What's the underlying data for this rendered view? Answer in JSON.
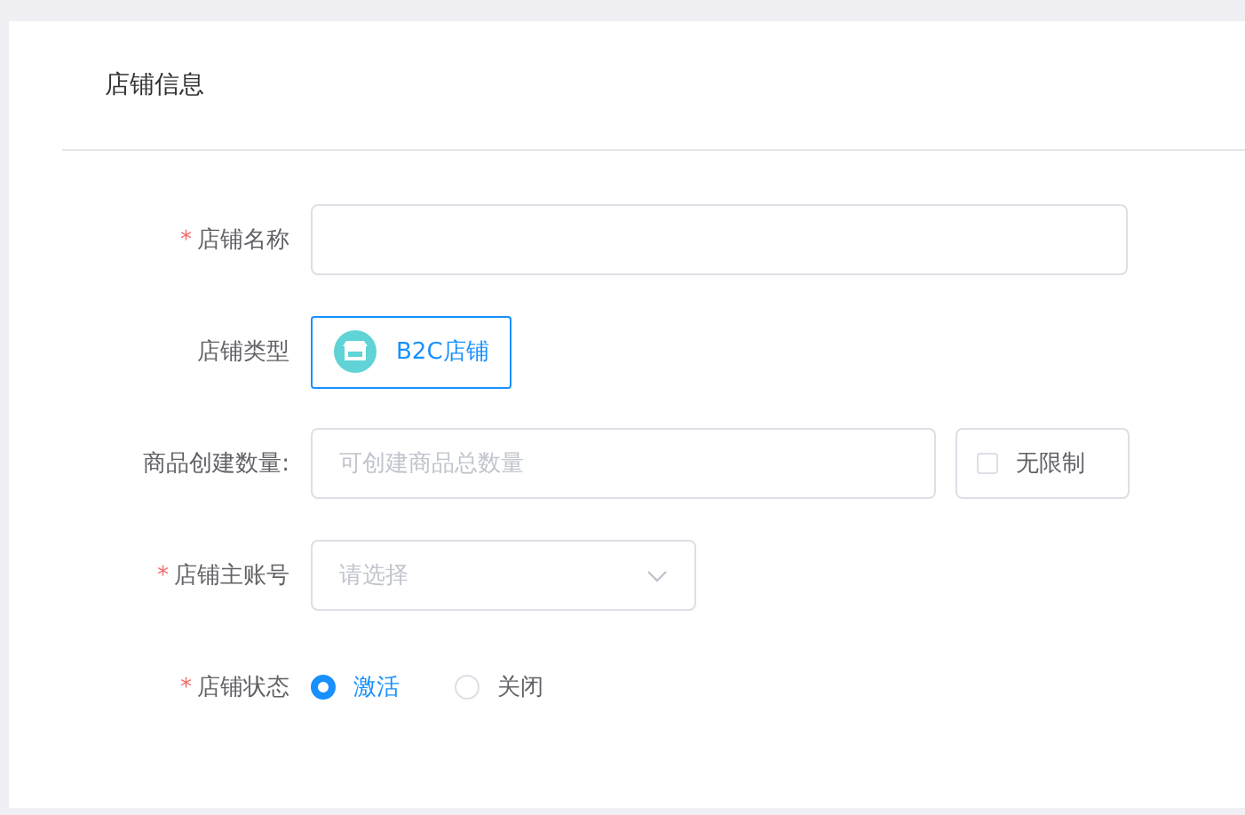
{
  "section": {
    "title": "店铺信息"
  },
  "fields": [
    {
      "kind": "text",
      "label": "店铺名称",
      "required_mark": "*"
    },
    {
      "kind": "store_type",
      "label": "店铺类型",
      "option": {
        "label": "B2C店铺",
        "selected": true
      }
    },
    {
      "kind": "number_with_checkbox",
      "label": "商品创建数量:",
      "placeholder": "可创建商品总数量",
      "checkbox": {
        "label": "无限制",
        "checked": false
      }
    },
    {
      "kind": "select",
      "label": "店铺主账号",
      "required_mark": "*",
      "placeholder": "请选择"
    },
    {
      "kind": "radio",
      "label": "店铺状态",
      "required_mark": "*",
      "options": [
        {
          "label": "激活",
          "selected": true
        },
        {
          "label": "关闭",
          "selected": false
        }
      ]
    }
  ]
}
